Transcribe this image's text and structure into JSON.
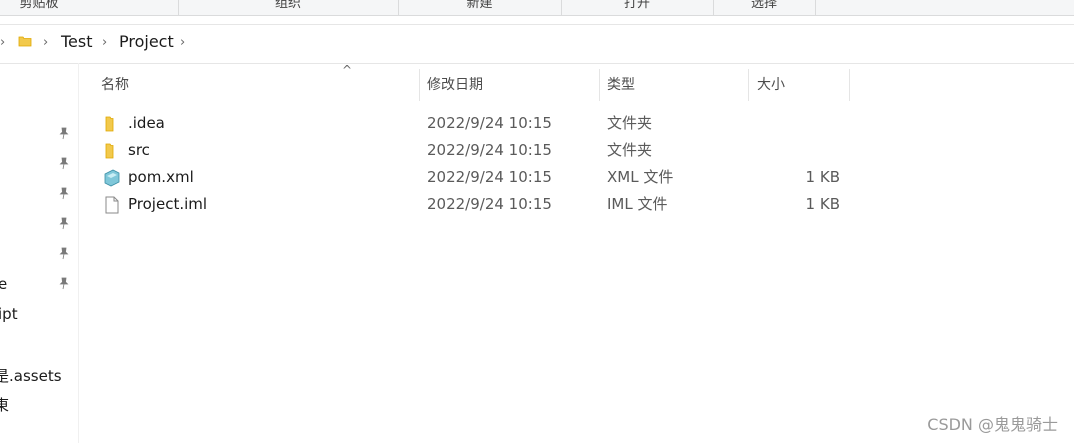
{
  "ribbon": {
    "groups": [
      "剪贴板",
      "组织",
      "新建",
      "打开",
      "选择"
    ]
  },
  "address": {
    "crumbs": [
      "Test",
      "Project"
    ]
  },
  "nav": {
    "items": [
      "e",
      "ipt",
      "",
      "是.assets",
      "東"
    ]
  },
  "columns": {
    "name": "名称",
    "date": "修改日期",
    "type": "类型",
    "size": "大小"
  },
  "files": [
    {
      "name": ".idea",
      "date": "2022/9/24 10:15",
      "type": "文件夹",
      "size": "",
      "icon": "folder-icon"
    },
    {
      "name": "src",
      "date": "2022/9/24 10:15",
      "type": "文件夹",
      "size": "",
      "icon": "folder-icon"
    },
    {
      "name": "pom.xml",
      "date": "2022/9/24 10:15",
      "type": "XML 文件",
      "size": "1 KB",
      "icon": "xml-file-icon"
    },
    {
      "name": "Project.iml",
      "date": "2022/9/24 10:15",
      "type": "IML 文件",
      "size": "1 KB",
      "icon": "file-icon"
    }
  ],
  "watermark": "CSDN @鬼鬼骑士",
  "colors": {
    "folder": "#f2c94c",
    "folder_dark": "#e0a800"
  }
}
